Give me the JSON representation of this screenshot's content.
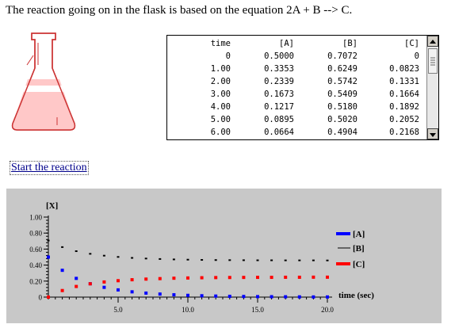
{
  "heading": "The reaction going on in the flask is based on the equation 2A + B --> C.",
  "link_label": "Start the reaction",
  "table": {
    "headers": [
      "time",
      "[A]",
      "[B]",
      "[C]"
    ],
    "rows": [
      [
        "0",
        "0.5000",
        "0.7072",
        "0"
      ],
      [
        "1.00",
        "0.3353",
        "0.6249",
        "0.0823"
      ],
      [
        "2.00",
        "0.2339",
        "0.5742",
        "0.1331"
      ],
      [
        "3.00",
        "0.1673",
        "0.5409",
        "0.1664"
      ],
      [
        "4.00",
        "0.1217",
        "0.5180",
        "0.1892"
      ],
      [
        "5.00",
        "0.0895",
        "0.5020",
        "0.2052"
      ],
      [
        "6.00",
        "0.0664",
        "0.4904",
        "0.2168"
      ]
    ]
  },
  "colors": {
    "A": "#0000ff",
    "B": "#000000",
    "C": "#ff0000",
    "flask_liquid": "#ffc8c8",
    "flask_outline": "#cc3333",
    "chart_bg": "#c8c8c8"
  },
  "chart_data": {
    "type": "scatter",
    "ylabel": "[X]",
    "xlabel": "time (sec)",
    "ylim": [
      0,
      1.0
    ],
    "xlim": [
      0,
      20
    ],
    "y_ticks": [
      "1.00",
      "0.80",
      "0.60",
      "0.40",
      "0.20",
      "0"
    ],
    "x_ticks": [
      "5.0",
      "10.0",
      "15.0",
      "20.0"
    ],
    "legend_position": "right",
    "series": [
      {
        "name": "[A]",
        "x": [
          0,
          1,
          2,
          3,
          4,
          5,
          6,
          7,
          8,
          9,
          10,
          11,
          12,
          13,
          14,
          15,
          16,
          17,
          18,
          19,
          20
        ],
        "y": [
          0.5,
          0.335,
          0.234,
          0.167,
          0.122,
          0.09,
          0.066,
          0.05,
          0.038,
          0.029,
          0.022,
          0.017,
          0.013,
          0.01,
          0.008,
          0.006,
          0.005,
          0.004,
          0.003,
          0.002,
          0.002
        ]
      },
      {
        "name": "[B]",
        "x": [
          0,
          1,
          2,
          3,
          4,
          5,
          6,
          7,
          8,
          9,
          10,
          11,
          12,
          13,
          14,
          15,
          16,
          17,
          18,
          19,
          20
        ],
        "y": [
          0.707,
          0.625,
          0.574,
          0.541,
          0.518,
          0.502,
          0.49,
          0.482,
          0.476,
          0.471,
          0.468,
          0.465,
          0.463,
          0.462,
          0.461,
          0.46,
          0.46,
          0.459,
          0.459,
          0.459,
          0.458
        ]
      },
      {
        "name": "[C]",
        "x": [
          0,
          1,
          2,
          3,
          4,
          5,
          6,
          7,
          8,
          9,
          10,
          11,
          12,
          13,
          14,
          15,
          16,
          17,
          18,
          19,
          20
        ],
        "y": [
          0,
          0.082,
          0.133,
          0.166,
          0.189,
          0.205,
          0.217,
          0.225,
          0.231,
          0.236,
          0.239,
          0.242,
          0.244,
          0.245,
          0.246,
          0.247,
          0.247,
          0.248,
          0.248,
          0.249,
          0.249
        ]
      }
    ]
  }
}
